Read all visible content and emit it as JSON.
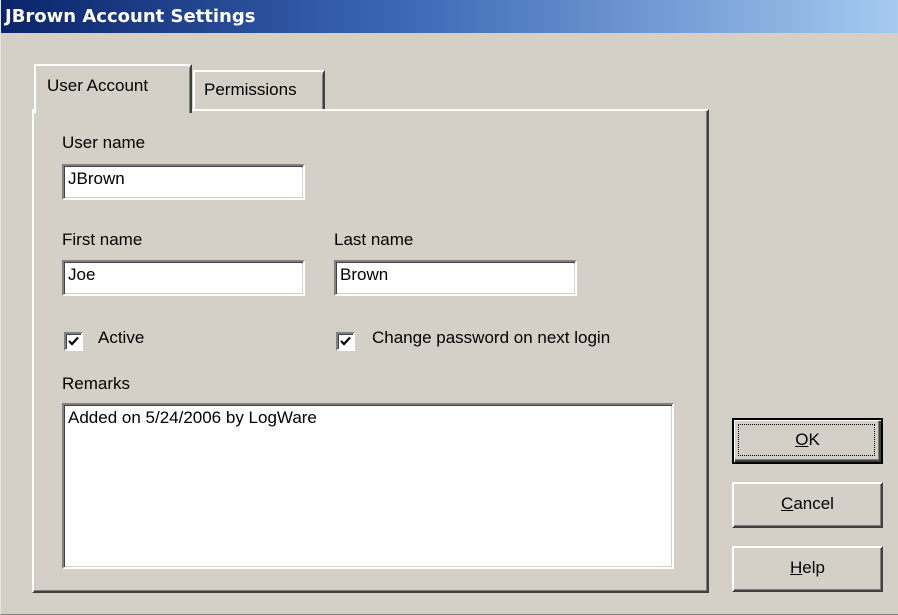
{
  "window": {
    "title": "JBrown Account Settings"
  },
  "tabs": [
    {
      "label": "User Account",
      "selected": true
    },
    {
      "label": "Permissions",
      "selected": false
    }
  ],
  "form": {
    "user_name": {
      "label": "User name",
      "value": "JBrown"
    },
    "first_name": {
      "label": "First name",
      "value": "Joe"
    },
    "last_name": {
      "label": "Last name",
      "value": "Brown"
    },
    "active": {
      "label": "Active",
      "checked": true
    },
    "change_password": {
      "label": "Change password on next login",
      "checked": true
    },
    "remarks": {
      "label": "Remarks",
      "value": "Added on 5/24/2006 by LogWare"
    }
  },
  "buttons": {
    "ok": {
      "mnemonic": "O",
      "rest": "K"
    },
    "cancel": {
      "mnemonic": "C",
      "rest": "ancel"
    },
    "help": {
      "mnemonic": "H",
      "rest": "elp"
    }
  },
  "colors": {
    "face": "#d4d0c8",
    "title_start": "#0a246a",
    "title_end": "#a6caf0"
  }
}
